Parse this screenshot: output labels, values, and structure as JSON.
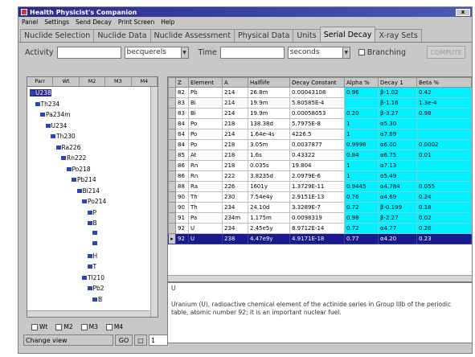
{
  "window": {
    "title": "Health Physicist's Companion"
  },
  "menu": [
    "Panel",
    "Settings",
    "Send Decay",
    "Print Screen",
    "Help"
  ],
  "tabs": [
    {
      "label": "Nuclide Selection",
      "active": false
    },
    {
      "label": "Nuclide Data",
      "active": false
    },
    {
      "label": "Nuclide Assessment",
      "active": false
    },
    {
      "label": "Physical Data",
      "active": false
    },
    {
      "label": "Units",
      "active": false
    },
    {
      "label": "Serial Decay",
      "active": true
    },
    {
      "label": "X-ray Sets",
      "active": false
    }
  ],
  "toolbar": {
    "activity_label": "Activity",
    "activity_value": "",
    "activity_unit": "becquerels",
    "time_label": "Time",
    "time_value": "",
    "time_unit": "seconds",
    "branching_label": "Branching",
    "compute_label": "COMPUTE"
  },
  "tree": {
    "headers": [
      "Parr",
      "Wt",
      "M2",
      "M3",
      "M4"
    ],
    "nodes": [
      {
        "label": "U238",
        "level": 0,
        "selected": true
      },
      {
        "label": "Th234",
        "level": 1
      },
      {
        "label": "Pa234m",
        "level": 2
      },
      {
        "label": "U234",
        "level": 3
      },
      {
        "label": "Th230",
        "level": 4
      },
      {
        "label": "Ra226",
        "level": 5
      },
      {
        "label": "Rn222",
        "level": 6
      },
      {
        "label": "Po218",
        "level": 7
      },
      {
        "label": "Pb214",
        "level": 8
      },
      {
        "label": "Bi214",
        "level": 9
      },
      {
        "label": "Po214",
        "level": 10
      },
      {
        "label": "P",
        "level": 11
      },
      {
        "label": "B",
        "level": 11
      },
      {
        "label": "",
        "level": 12
      },
      {
        "label": "",
        "level": 12
      },
      {
        "label": "H",
        "level": 11
      },
      {
        "label": "T",
        "level": 11
      },
      {
        "label": "Tl210",
        "level": 10
      },
      {
        "label": "Pb2",
        "level": 11
      },
      {
        "label": "B",
        "level": 12
      }
    ],
    "checks": [
      "Wt",
      "M2",
      "M3",
      "M4"
    ]
  },
  "statusbar": {
    "message": "Change view",
    "btn1": "GO",
    "value": "1"
  },
  "grid": {
    "columns": [
      "Z",
      "Element",
      "A",
      "Halflife",
      "Decay Constant",
      "Alpha %",
      "Decay 1",
      "Beta %"
    ],
    "rows": [
      [
        "82",
        "Pb",
        "214",
        "26.8m",
        "0.00043108",
        "0.96",
        "β-1.02",
        "0.42"
      ],
      [
        "83",
        "Bi",
        "214",
        "19.9m",
        "5.80585E-4",
        "",
        "β-1.16",
        "1.3e-4"
      ],
      [
        "83",
        "Bi",
        "214",
        "19.9m",
        "0.00058053",
        "0.20",
        "β-3.27",
        "0.98"
      ],
      [
        "84",
        "Po",
        "218",
        "138.38d",
        "5.7975E-8",
        "1",
        "α5.30",
        ""
      ],
      [
        "84",
        "Po",
        "214",
        "1.64e-4s",
        "4226.5",
        "1",
        "α7.69",
        ""
      ],
      [
        "84",
        "Po",
        "218",
        "3.05m",
        "0.0037877",
        "0.9998",
        "α6.00",
        "0.0002"
      ],
      [
        "85",
        "At",
        "218",
        "1.6s",
        "0.43322",
        "0.84",
        "α6.75",
        "0.01"
      ],
      [
        "86",
        "Rn",
        "218",
        "0.035s",
        "19.804",
        "1",
        "α7.13",
        ""
      ],
      [
        "86",
        "Rn",
        "222",
        "3.8235d",
        "2.0979E-6",
        "1",
        "α5.49",
        ""
      ],
      [
        "88",
        "Ra",
        "226",
        "1601y",
        "1.3729E-11",
        "0.9445",
        "α4.784",
        "0.055"
      ],
      [
        "90",
        "Th",
        "230",
        "7.54e4y",
        "2.9151E-13",
        "0.76",
        "α4.69",
        "0.24"
      ],
      [
        "90",
        "Th",
        "234",
        "24.10d",
        "3.3289E-7",
        "0.72",
        "β-0.199",
        "0.18"
      ],
      [
        "91",
        "Pa",
        "234m",
        "1.175m",
        "0.0098319",
        "0.98",
        "β-2.27",
        "0.02"
      ],
      [
        "92",
        "U",
        "234",
        "2.45e5y",
        "8.9712E-14",
        "0.72",
        "α4.77",
        "0.28"
      ],
      [
        "92",
        "U",
        "238",
        "4.47e9y",
        "4.9171E-18",
        "0.77",
        "α4.20",
        "0.23"
      ]
    ],
    "selected_row": 14
  },
  "description": {
    "title": "U",
    "text": "Uranium (U), radioactive chemical element of the actinide series in Group IIIb of the periodic table, atomic number 92; it is an important nuclear fuel."
  }
}
